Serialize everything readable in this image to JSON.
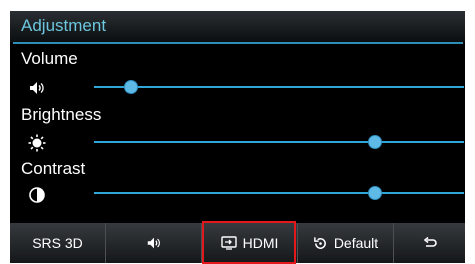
{
  "osd": {
    "title": "Adjustment",
    "sliders": [
      {
        "label": "Volume",
        "icon": "speaker-icon",
        "level": 0.1
      },
      {
        "label": "Brightness",
        "icon": "brightness-icon",
        "level": 0.76
      },
      {
        "label": "Contrast",
        "icon": "contrast-icon",
        "level": 0.76
      }
    ]
  },
  "buttons": [
    {
      "label": "SRS 3D",
      "icon": ""
    },
    {
      "label": "",
      "icon": "speaker-icon"
    },
    {
      "label": "HDMI",
      "icon": "input-source-icon"
    },
    {
      "label": "Default",
      "icon": "reset-icon"
    },
    {
      "label": "",
      "icon": "return-icon"
    }
  ],
  "colors": {
    "accent": "#6cc6de",
    "slider": "#2ea6d8",
    "highlight": "#e3181d"
  }
}
